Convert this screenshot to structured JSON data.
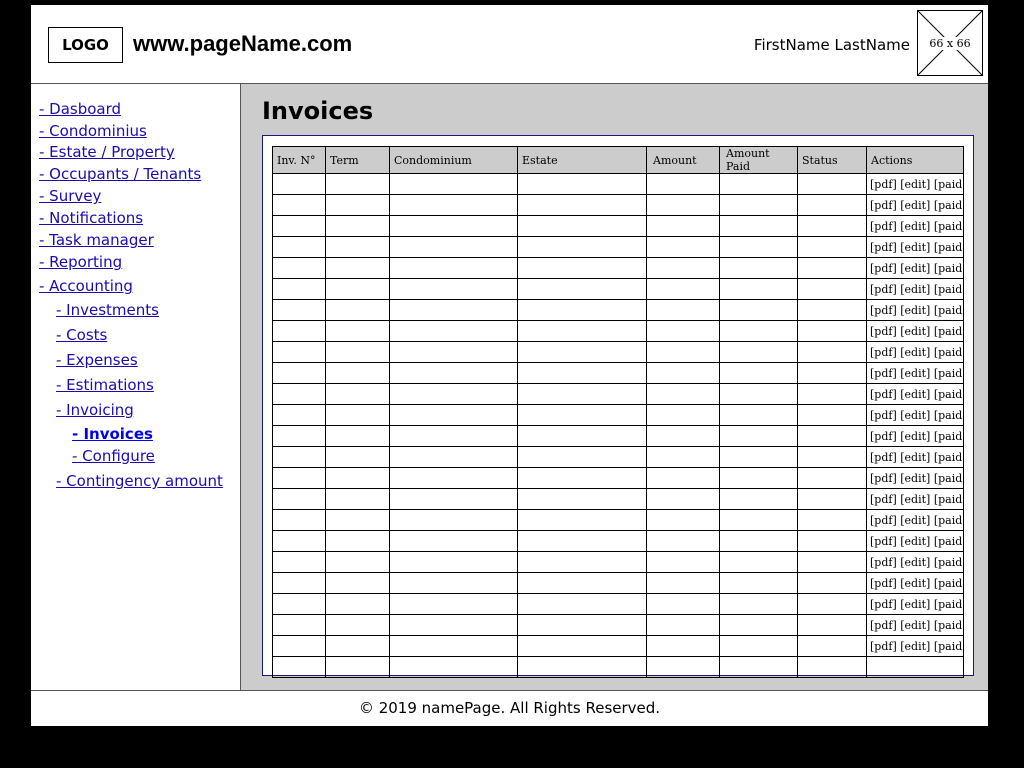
{
  "header": {
    "logo": "LOGO",
    "site_name": "www.pageName.com",
    "user_name": "FirstName LastName",
    "avatar_placeholder": "66 x 66"
  },
  "sidebar": {
    "items": [
      {
        "label": "- Dasboard",
        "level": 0
      },
      {
        "label": "- Condominius",
        "level": 0
      },
      {
        "label": "- Estate / Property",
        "level": 0
      },
      {
        "label": "- Occupants / Tenants",
        "level": 0
      },
      {
        "label": "- Survey",
        "level": 0
      },
      {
        "label": "- Notifications",
        "level": 0
      },
      {
        "label": "- Task manager",
        "level": 0
      },
      {
        "label": "- Reporting",
        "level": 0
      },
      {
        "label": "- Accounting",
        "level": 0
      },
      {
        "label": "- Investments",
        "level": 1
      },
      {
        "label": "- Costs",
        "level": 1
      },
      {
        "label": "- Expenses",
        "level": 1
      },
      {
        "label": "- Estimations",
        "level": 1
      },
      {
        "label": "- Invoicing",
        "level": 1
      },
      {
        "label": "- Invoices",
        "level": 2,
        "active": true
      },
      {
        "label": "- Configure",
        "level": 2
      },
      {
        "label": "- Contingency amount",
        "level": 1
      }
    ]
  },
  "main": {
    "title": "Invoices",
    "table": {
      "columns": [
        "Inv. N°",
        "Term",
        "Condominium",
        "Estate",
        "Amount",
        "Amount Paid",
        "Status",
        "Actions"
      ],
      "row_count": 24,
      "rows_with_actions": 23,
      "actions": [
        "[pdf]",
        "[edit]",
        "[paid]"
      ]
    }
  },
  "footer": {
    "text": "© 2019 namePage. All Rights Reserved."
  },
  "colors": {
    "background": "#000000",
    "panel_gray": "#cccccc",
    "link": "#1a0dab"
  }
}
